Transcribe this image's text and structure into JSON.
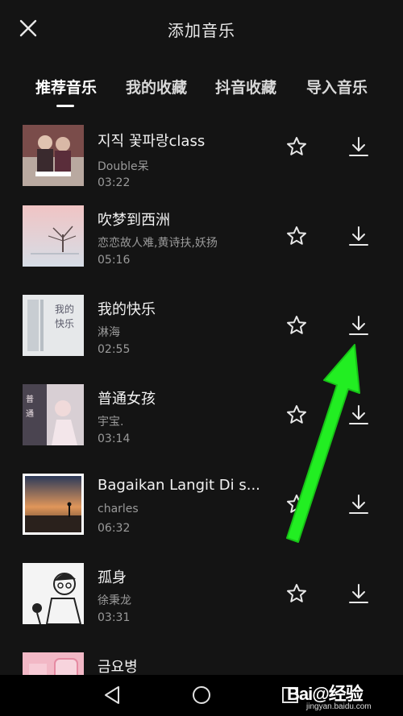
{
  "header": {
    "title": "添加音乐"
  },
  "tabs": [
    {
      "label": "推荐音乐",
      "active": true
    },
    {
      "label": "我的收藏",
      "active": false
    },
    {
      "label": "抖音收藏",
      "active": false
    },
    {
      "label": "导入音乐",
      "active": false
    }
  ],
  "songs": [
    {
      "title": "지직 꽃파랑class",
      "artist": "Double呆",
      "duration": "03:22",
      "thumb_bg": "#b9a9a0"
    },
    {
      "title": "吹梦到西洲",
      "artist": "恋恋故人难,黄诗扶,妖扬",
      "duration": "05:16",
      "thumb_bg": "#e8c8c8"
    },
    {
      "title": "我的快乐",
      "artist": "淋海",
      "duration": "02:55",
      "thumb_bg": "#e6e8ea"
    },
    {
      "title": "普通女孩",
      "artist": "宇宝.",
      "duration": "03:14",
      "thumb_bg": "#d8cfd4"
    },
    {
      "title": "Bagaikan Langit Di s...",
      "artist": "charles",
      "duration": "06:32",
      "thumb_bg": "#e09a5a"
    },
    {
      "title": "孤身",
      "artist": "徐秉龙",
      "duration": "03:31",
      "thumb_bg": "#f4f4f4"
    },
    {
      "title": "금요병",
      "artist": "",
      "duration": "",
      "thumb_bg": "#f2b8c6"
    }
  ],
  "watermark": {
    "logo": "Bai@经验",
    "url": "jingyan.baidu.com"
  },
  "colors": {
    "background": "#141414",
    "annotation_arrow": "#22ee22"
  }
}
